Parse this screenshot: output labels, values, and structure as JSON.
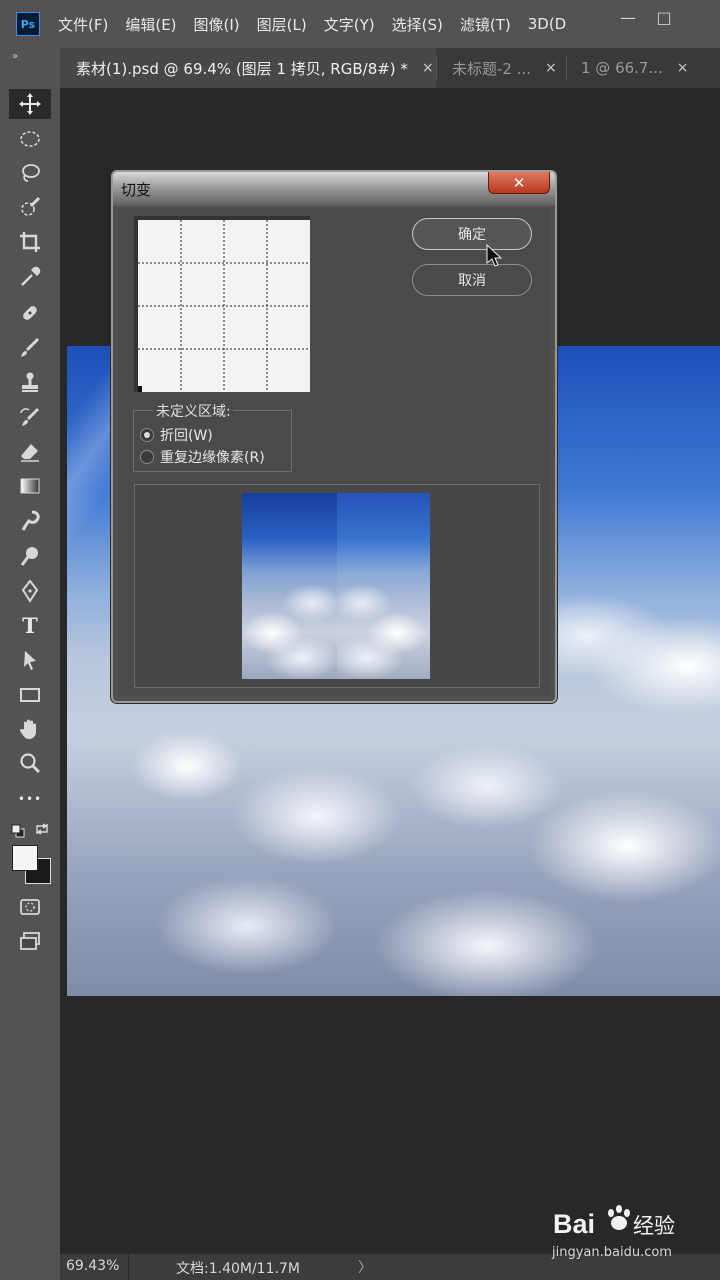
{
  "app": {
    "logo_text": "Ps"
  },
  "menu": {
    "items": [
      "文件(F)",
      "编辑(E)",
      "图像(I)",
      "图层(L)",
      "文字(Y)",
      "选择(S)",
      "滤镜(T)",
      "3D(D"
    ]
  },
  "window_controls": {
    "minimize": "—",
    "maximize": "□"
  },
  "tabs": [
    {
      "label": "素材(1).psd @ 69.4% (图层 1 拷贝, RGB/8#) *",
      "close": "×",
      "active": true
    },
    {
      "label": "未标题-2 ...",
      "close": "×",
      "active": false
    },
    {
      "label": "1 @ 66.7...",
      "close": "×",
      "active": false
    }
  ],
  "toolbar": {
    "collapse": "»",
    "tools": [
      "move-tool",
      "marquee-tool",
      "lasso-tool",
      "quick-select-tool",
      "crop-tool",
      "eyedropper-tool",
      "healing-brush-tool",
      "brush-tool",
      "clone-stamp-tool",
      "history-brush-tool",
      "eraser-tool",
      "gradient-tool",
      "blur-tool",
      "dodge-tool",
      "pen-tool",
      "type-tool",
      "path-select-tool",
      "rectangle-tool",
      "hand-tool",
      "zoom-tool",
      "more-tools"
    ],
    "type_glyph": "T",
    "more_glyph": "•••"
  },
  "dialog": {
    "title": "切变",
    "close": "✕",
    "ok_label": "确定",
    "cancel_label": "取消",
    "undefined_area": {
      "legend": "未定义区域:",
      "options": [
        {
          "label": "折回(W)",
          "checked": true
        },
        {
          "label": "重复边缘像素(R)",
          "checked": false
        }
      ]
    }
  },
  "status": {
    "zoom": "69.43%",
    "doc": "文档:1.40M/11.7M",
    "arrow": "〉"
  },
  "watermark": {
    "brand_left": "Bai",
    "brand_right": "经验",
    "url": "jingyan.baidu.com"
  },
  "colors": {
    "menubar": "#535353",
    "workspace": "#282828",
    "accent_ps": "#31a8ff",
    "close_red": "#c9452a"
  }
}
